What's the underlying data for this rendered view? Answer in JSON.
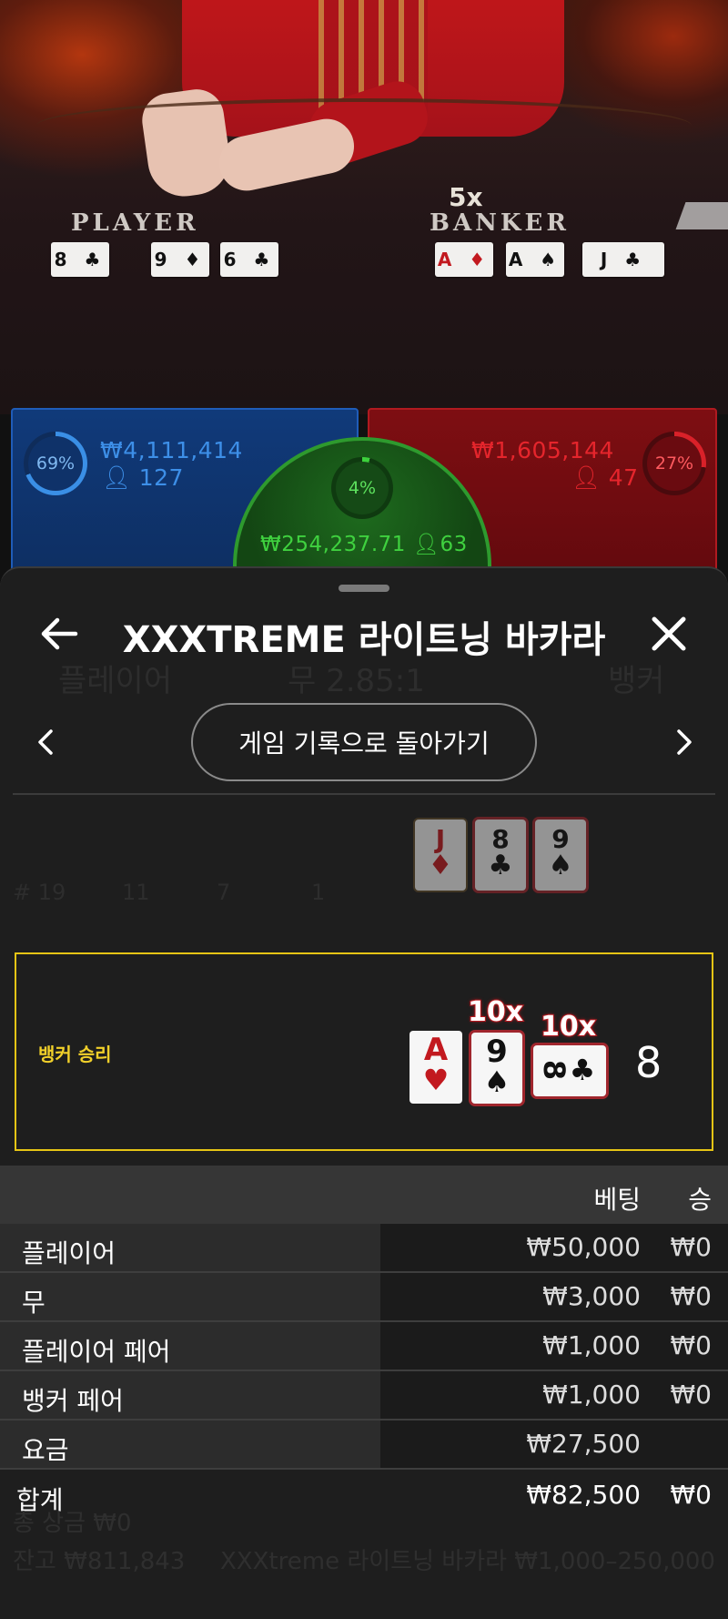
{
  "video": {
    "player_label": "PLAYER",
    "banker_label": "BANKER",
    "banker_multiplier": "5x",
    "player_cards": [
      {
        "text": "8 ♣",
        "red": false
      },
      {
        "text": "9 ♦",
        "red": false
      },
      {
        "text": "6 ♣",
        "red": false
      }
    ],
    "banker_cards": [
      {
        "text": "A ♦",
        "red": true
      },
      {
        "text": "A ♠",
        "red": false
      },
      {
        "text": "J ♣",
        "red": false
      }
    ]
  },
  "bet_strip": {
    "player": {
      "percent": "69%",
      "amount": "₩4,111,414",
      "players": "127",
      "ratio": 0.69
    },
    "tie": {
      "percent": "4%",
      "amount": "₩254,237.71",
      "players": "63",
      "ratio": 0.04
    },
    "banker": {
      "percent": "27%",
      "amount": "₩1,605,144",
      "players": "47",
      "ratio": 0.27
    }
  },
  "sheet": {
    "title": "XXXTREME 라이트닝 바카라",
    "back_to_history": "게임 기록으로 돌아가기",
    "ghost": {
      "player": "플레이어",
      "tie": "무 2.85:1",
      "banker": "뱅커",
      "count_round": "# 19",
      "count_p": "11",
      "count_b": "7",
      "count_t": "1",
      "footer_left": "잔고 ₩811,843",
      "footer_right": "XXXtreme 라이트닝 바카라 ₩1,000–250,000",
      "total_win": "총 상금 ₩0"
    },
    "dim_cards": [
      {
        "rank": "J",
        "suit": "♦",
        "red": true
      },
      {
        "rank": "8",
        "suit": "♣",
        "red": false
      },
      {
        "rank": "9",
        "suit": "♠",
        "red": false
      }
    ],
    "result": {
      "label": "뱅커 승리",
      "total": "8",
      "cards": [
        {
          "rank": "A",
          "suit": "♥",
          "red": true,
          "multiplier": ""
        },
        {
          "rank": "9",
          "suit": "♠",
          "red": false,
          "multiplier": "10x"
        },
        {
          "rank": "8",
          "suit": "♣",
          "red": false,
          "multiplier": "10x"
        }
      ]
    },
    "table": {
      "header_bet": "베팅",
      "header_win": "승",
      "rows": [
        {
          "name": "플레이어",
          "bet": "₩50,000",
          "win": "₩0"
        },
        {
          "name": "무",
          "bet": "₩3,000",
          "win": "₩0"
        },
        {
          "name": "플레이어 페어",
          "bet": "₩1,000",
          "win": "₩0"
        },
        {
          "name": "뱅커 페어",
          "bet": "₩1,000",
          "win": "₩0"
        },
        {
          "name": "요금",
          "bet": "₩27,500",
          "win": ""
        }
      ],
      "total": {
        "name": "합계",
        "bet": "₩82,500",
        "win": "₩0"
      }
    }
  },
  "colors": {
    "player_blue": "#3d8fe8",
    "banker_red": "#e5252c",
    "tie_green": "#3fd13f",
    "winner_gold": "#e6c515"
  }
}
